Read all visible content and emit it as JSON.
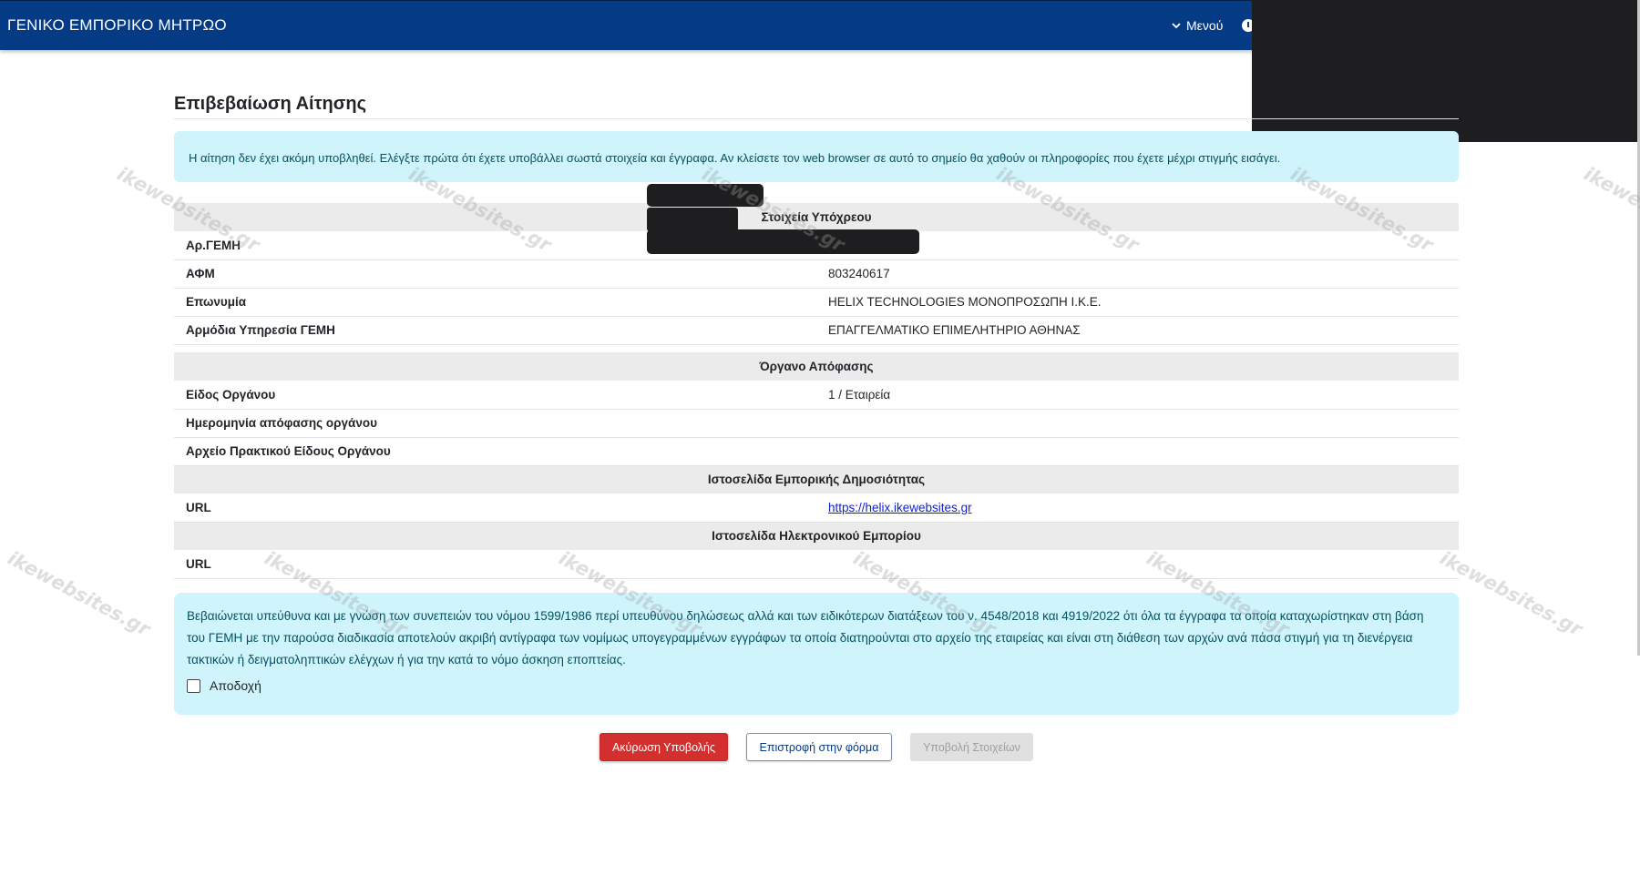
{
  "header": {
    "brand": "ΓΕΝΙΚΟ ΕΜΠΟΡΙΚΟ ΜΗΤΡΩΟ",
    "menu_label": "Μενού",
    "menu_icon": "chevron-down-icon",
    "info_icon": "info-circle-icon"
  },
  "page": {
    "title": "Επιβεβαίωση Αίτησης",
    "notice": "Η αίτηση δεν έχει ακόμη υποβληθεί. Ελέγξτε πρώτα ότι έχετε υποβάλλει σωστά στοιχεία και έγγραφα. Αν κλείσετε τον web browser σε αυτό το σημείο θα χαθούν οι πληροφορίες που έχετε μέχρι στιγμής εισάγει."
  },
  "sections": {
    "obligor": {
      "heading": "Στοιχεία Υπόχρεου",
      "rows": [
        {
          "label": "Αρ.ΓΕΜΗ",
          "value": ""
        },
        {
          "label": "ΑΦΜ",
          "value": "803240617"
        },
        {
          "label": "Επωνυμία",
          "value": "HELIX TECHNOLOGIES ΜΟΝΟΠΡΟΣΩΠΗ Ι.Κ.Ε."
        },
        {
          "label": "Αρμόδια Υπηρεσία ΓΕΜΗ",
          "value": "ΕΠΑΓΓΕΛΜΑΤΙΚΟ ΕΠΙΜΕΛΗΤΗΡΙΟ ΑΘΗΝΑΣ"
        }
      ]
    },
    "decision_body": {
      "heading": "Όργανο Απόφασης",
      "rows": [
        {
          "label": "Είδος Οργάνου",
          "value": "1 / Εταιρεία"
        },
        {
          "label": "Ημερομηνία απόφασης οργάνου",
          "value": ""
        },
        {
          "label": "Αρχείο Πρακτικού Είδους Οργάνου",
          "value": ""
        }
      ]
    },
    "publicity_site": {
      "heading": "Ιστοσελίδα Εμπορικής Δημοσιότητας",
      "rows": [
        {
          "label": "URL",
          "value": "https://helix.ikewebsites.gr"
        }
      ]
    },
    "eshop_site": {
      "heading": "Ιστοσελίδα Ηλεκτρονικού Εμπορίου",
      "rows": [
        {
          "label": "URL",
          "value": ""
        }
      ]
    }
  },
  "declaration": {
    "text": "Βεβαιώνεται υπεύθυνα και με γνώση των συνεπειών του νόμου 1599/1986 περί υπευθύνου δηλώσεως αλλά και των ειδικότερων διατάξεων του ν. 4548/2018 και 4919/2022 ότι όλα τα έγγραφα τα οποία καταχωρίστηκαν στη βάση του ΓΕΜΗ με την παρούσα διαδικασία αποτελούν ακριβή αντίγραφα των νομίμως υπογεγραμμένων εγγράφων τα οποία διατηρούνται στο αρχείο της εταιρείας και είναι στη διάθεση των αρχών ανά πάσα στιγμή για τη διενέργεια τακτικών ή δειγματοληπτικών ελέγχων ή για την κατά το νόμο άσκηση εποπτείας.",
    "accept_label": "Αποδοχή",
    "accepted": false
  },
  "buttons": {
    "cancel": "Ακύρωση Υποβολής",
    "back": "Επιστροφή στην φόρμα",
    "submit": "Υποβολή Στοιχείων"
  },
  "watermark": "ikewebsites.gr",
  "colors": {
    "header_bg": "#053a85",
    "alert_bg": "#cff4fc",
    "alert_text": "#055160",
    "cancel_bg": "#d32f2f",
    "disabled_bg": "#e0e0e0"
  }
}
